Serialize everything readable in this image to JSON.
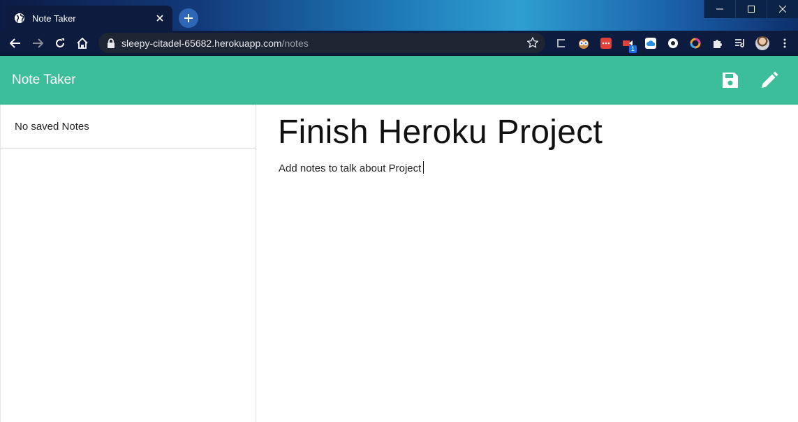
{
  "browser": {
    "tab": {
      "title": "Note Taker",
      "icon": "globe-icon"
    },
    "url": {
      "host": "sleepy-citadel-65682.herokuapp.com",
      "path": "/notes"
    },
    "extension_badge": "1",
    "colors": {
      "tab_bg": "#0d1b3e",
      "omnibox_bg": "#1e2533"
    }
  },
  "app": {
    "brand": "Note Taker",
    "actions": {
      "save_icon": "save-icon",
      "new_note_icon": "pencil-icon"
    },
    "colors": {
      "accent": "#3dbe9a"
    },
    "sidebar": {
      "empty_message": "No saved Notes"
    },
    "note": {
      "title": "Finish Heroku Project",
      "text": "Add notes to talk about Project"
    }
  }
}
